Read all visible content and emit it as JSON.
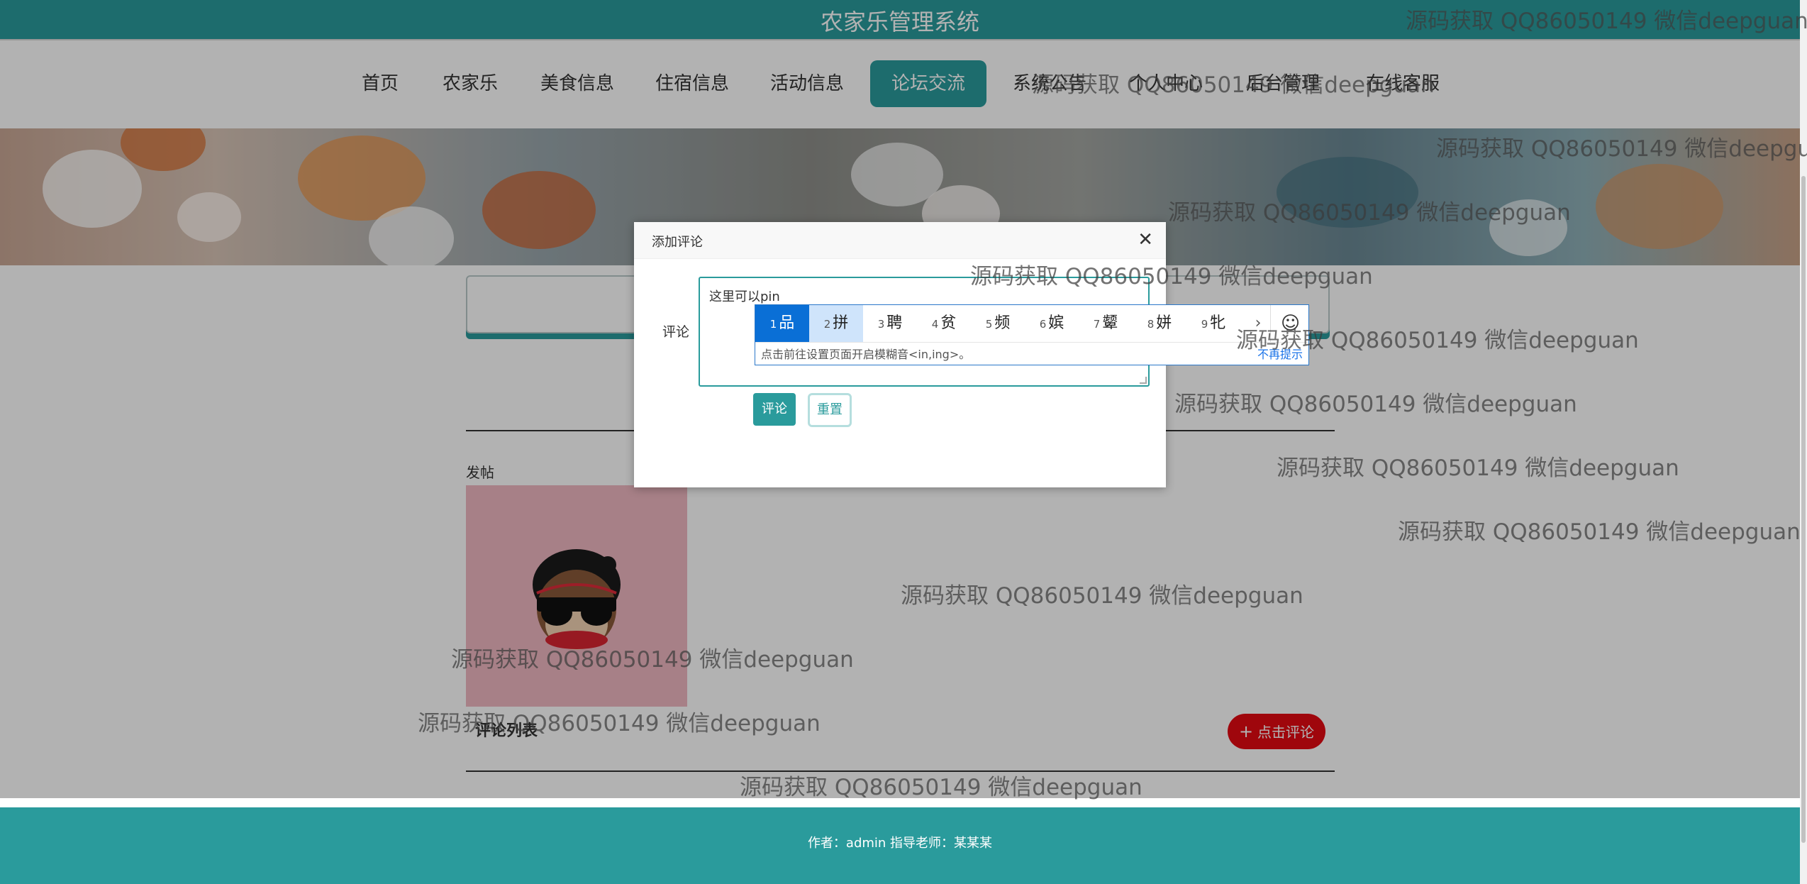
{
  "header": {
    "title": "农家乐管理系统"
  },
  "nav": {
    "items": [
      {
        "label": "首页"
      },
      {
        "label": "农家乐"
      },
      {
        "label": "美食信息"
      },
      {
        "label": "住宿信息"
      },
      {
        "label": "活动信息"
      },
      {
        "label": "论坛交流",
        "active": true
      },
      {
        "label": "系统公告"
      },
      {
        "label": "个人中心"
      },
      {
        "label": "后台管理"
      },
      {
        "label": "在线客服"
      }
    ]
  },
  "main": {
    "post_label": "发帖",
    "comment_list_title": "评论列表",
    "add_comment_button": "点击评论"
  },
  "dialog": {
    "title": "添加评论",
    "field_label": "评论",
    "textarea_value": "这里可以pin",
    "submit_label": "评论",
    "reset_label": "重置"
  },
  "ime": {
    "candidates": [
      {
        "num": "1",
        "char": "品"
      },
      {
        "num": "2",
        "char": "拼"
      },
      {
        "num": "3",
        "char": "聘"
      },
      {
        "num": "4",
        "char": "贫"
      },
      {
        "num": "5",
        "char": "频"
      },
      {
        "num": "6",
        "char": "嫔"
      },
      {
        "num": "7",
        "char": "颦"
      },
      {
        "num": "8",
        "char": "姘"
      },
      {
        "num": "9",
        "char": "牝"
      }
    ],
    "hint": "点击前往设置页面开启模糊音<in,ing>。",
    "dismiss": "不再提示"
  },
  "footer": {
    "text": "作者：admin 指导老师：某某某"
  },
  "watermark": "源码获取 QQ86050149 微信deepguan",
  "colors": {
    "primary": "#2a9b9c",
    "danger": "#e40a12",
    "ime_selected": "#0a6fd6"
  },
  "icons": {
    "close": "close-icon",
    "plus": "plus-icon",
    "emoji": "emoji-icon",
    "chevron": "chevron-right-icon"
  }
}
